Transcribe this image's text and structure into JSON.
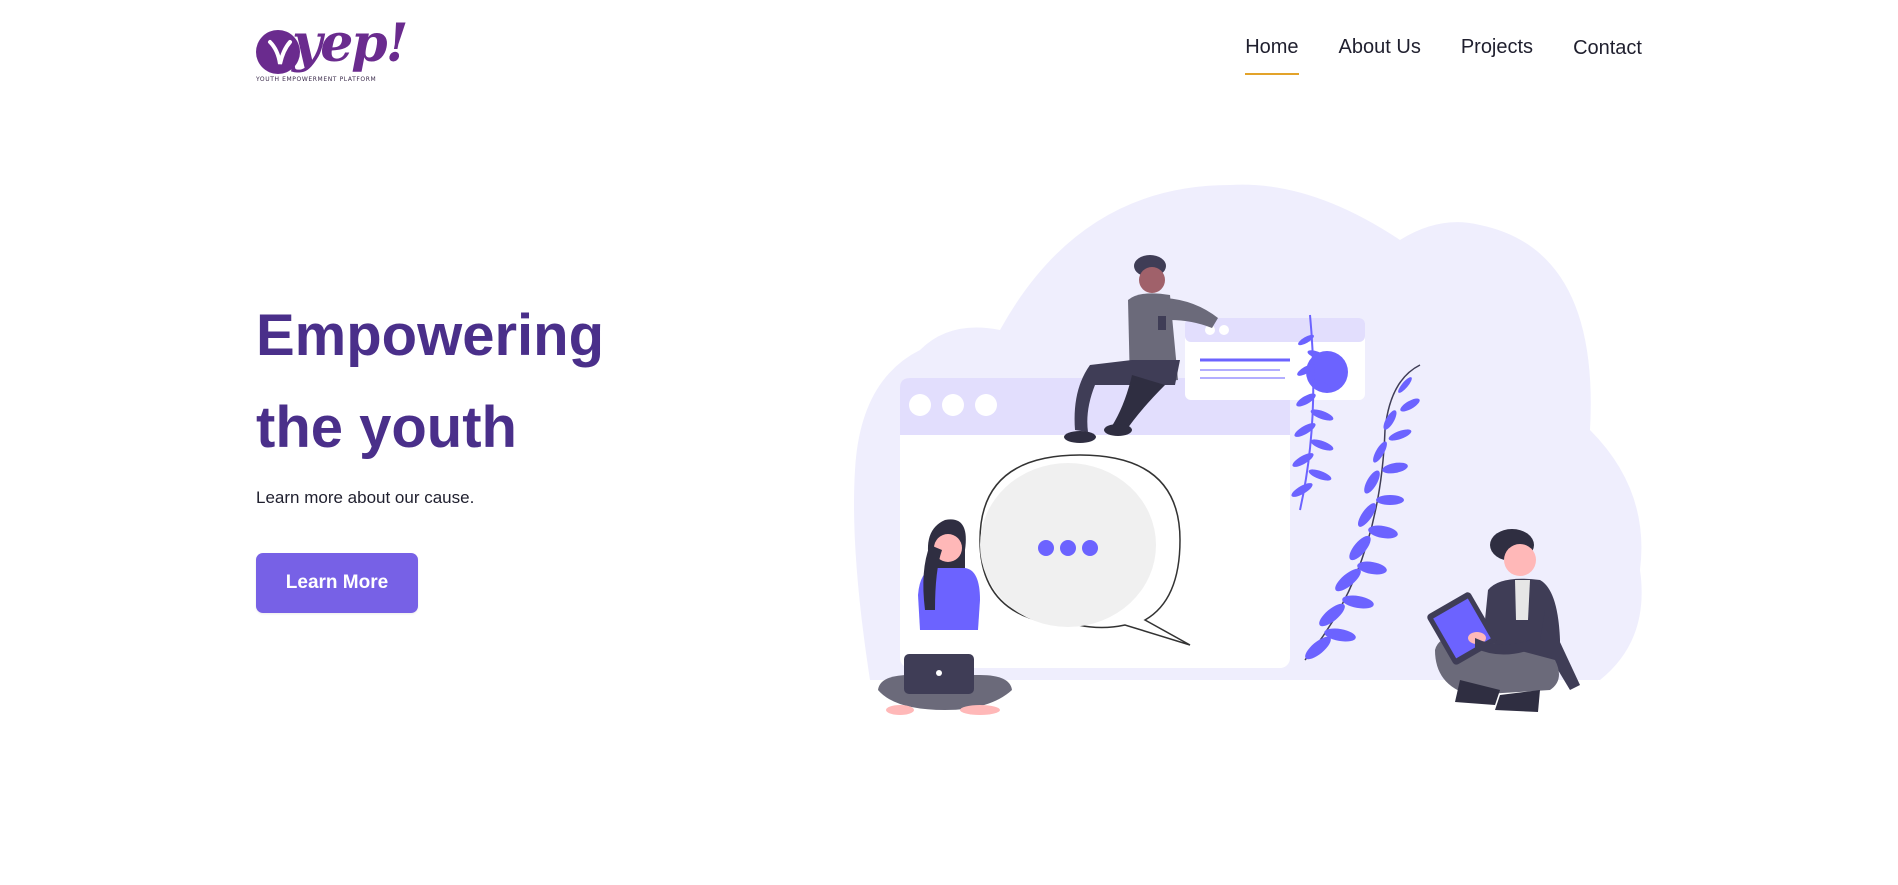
{
  "logo": {
    "word": "yep!",
    "tagline": "YOUTH EMPOWERMENT PLATFORM"
  },
  "nav": {
    "items": [
      {
        "label": "Home",
        "active": true
      },
      {
        "label": "About Us",
        "active": false
      },
      {
        "label": "Projects",
        "active": false
      },
      {
        "label": "Contact",
        "active": false
      }
    ]
  },
  "hero": {
    "title_line1": "Empowering",
    "title_line2": "the youth",
    "subtitle": "Learn more about our cause.",
    "cta_label": "Learn More"
  },
  "colors": {
    "brand": "#4a2f8a",
    "accent": "#7761e6",
    "nav_underline": "#e3a32a",
    "illustration_bg": "#efeefd"
  }
}
